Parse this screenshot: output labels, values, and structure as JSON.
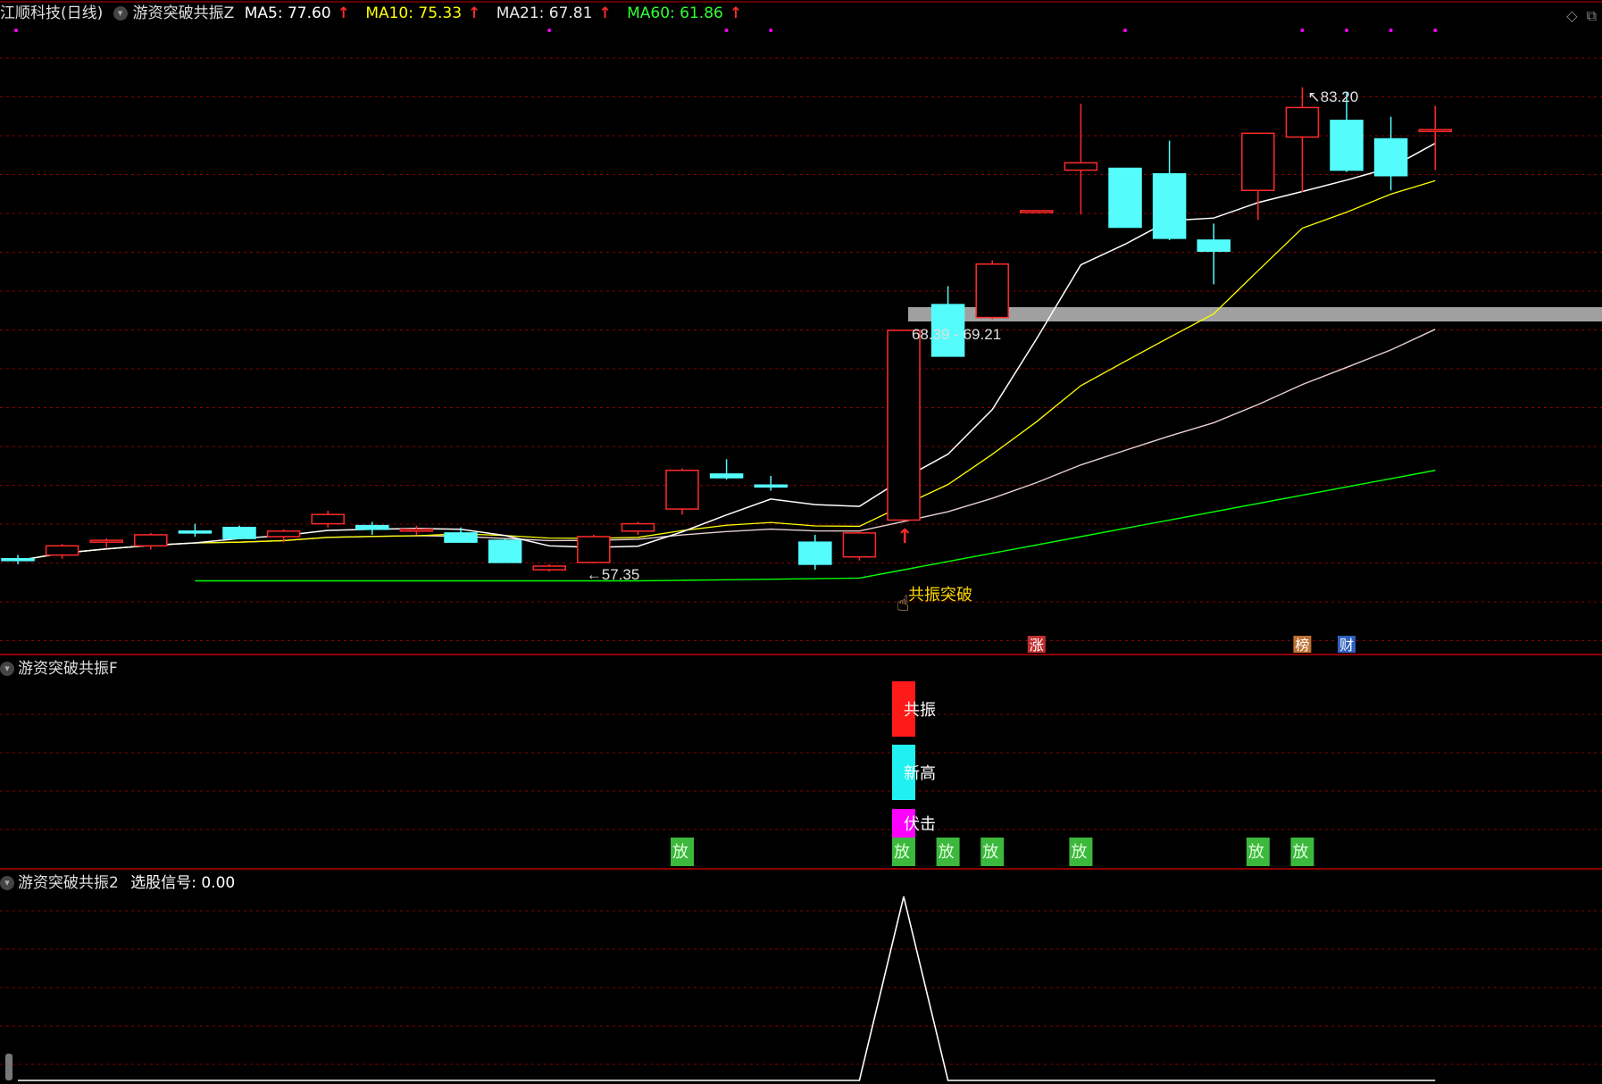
{
  "header": {
    "stock_name": "江顺科技(日线)",
    "indicator_name": "游资突破共振Z",
    "ma": [
      {
        "label": "MA5: 77.60",
        "color": "#ffffff"
      },
      {
        "label": "MA10: 75.33",
        "color": "#ffff00"
      },
      {
        "label": "MA21: 67.81",
        "color": "#ffffff"
      },
      {
        "label": "MA60: 61.86",
        "color": "#00ff00"
      }
    ]
  },
  "panels": {
    "panel2_title": "游资突破共振F",
    "panel3_title": "游资突破共振2",
    "panel3_value": "选股信号: 0.00"
  },
  "colors": {
    "up": "#ff2a2a",
    "down": "#54fcfc",
    "ma5": "#ffffff",
    "ma10": "#ffff00",
    "ma21": "#ffffff",
    "ma60": "#00ff00",
    "grid": "#8a0000",
    "support_band": "#a0a0a0"
  },
  "chart_data": {
    "type": "candlestick",
    "ohlc": [
      [
        57.6,
        57.8,
        57.3,
        57.5
      ],
      [
        57.8,
        58.4,
        57.6,
        58.3
      ],
      [
        58.5,
        58.7,
        58.2,
        58.6
      ],
      [
        58.3,
        59.0,
        58.1,
        58.9
      ],
      [
        59.1,
        59.5,
        58.8,
        59.0
      ],
      [
        59.3,
        59.4,
        58.8,
        58.7
      ],
      [
        58.8,
        59.2,
        58.5,
        59.1
      ],
      [
        59.5,
        60.2,
        59.3,
        60.0
      ],
      [
        59.4,
        59.6,
        58.9,
        59.2
      ],
      [
        59.1,
        59.4,
        58.9,
        59.2
      ],
      [
        59.0,
        59.3,
        58.6,
        58.5
      ],
      [
        58.6,
        58.7,
        57.5,
        57.4
      ],
      [
        57.0,
        57.3,
        56.9,
        57.2
      ],
      [
        57.4,
        58.9,
        57.35,
        58.8
      ],
      [
        59.1,
        59.6,
        58.9,
        59.5
      ],
      [
        60.3,
        62.5,
        60.0,
        62.4
      ],
      [
        62.2,
        63.0,
        61.9,
        62.0
      ],
      [
        61.6,
        62.1,
        61.3,
        61.5
      ],
      [
        58.5,
        58.9,
        57.0,
        57.3
      ],
      [
        57.7,
        59.1,
        57.5,
        59.0
      ],
      [
        59.7,
        70.0,
        59.7,
        70.0
      ],
      [
        71.4,
        72.4,
        68.6,
        68.6
      ],
      [
        70.7,
        73.8,
        70.6,
        73.6
      ],
      [
        76.5,
        76.5,
        76.5,
        76.5
      ],
      [
        78.7,
        82.3,
        76.3,
        79.1
      ],
      [
        78.8,
        77.3,
        75.9,
        75.6
      ],
      [
        78.5,
        80.3,
        74.9,
        75.0
      ],
      [
        74.9,
        75.8,
        72.5,
        74.3
      ],
      [
        77.6,
        80.0,
        76.0,
        80.7
      ],
      [
        80.5,
        83.2,
        77.5,
        82.1
      ],
      [
        81.4,
        82.9,
        78.6,
        78.7
      ],
      [
        80.4,
        81.6,
        77.6,
        78.4
      ],
      [
        80.8,
        82.2,
        78.7,
        80.9
      ]
    ],
    "annotations": [
      "83.20",
      "57.35",
      "68.39 - 69.21",
      "共振突破"
    ],
    "support_zone": [
      68.39,
      69.21
    ],
    "ylim": [
      54,
      86
    ],
    "signals_panel": {
      "labels": [
        "共振",
        "新高",
        "伏击",
        "放"
      ],
      "signal_bar_labels": [
        "放",
        "放",
        "放",
        "放",
        "放",
        "放",
        "放"
      ]
    },
    "stock_signal": {
      "series_name": "选股信号",
      "peak_index": 20
    },
    "event_tags": [
      "涨",
      "榜",
      "财"
    ]
  }
}
